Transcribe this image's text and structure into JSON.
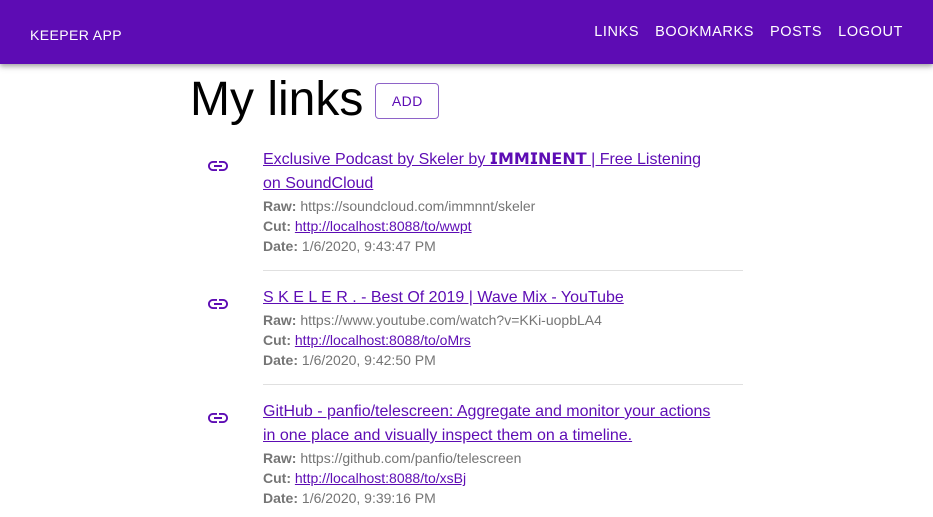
{
  "appbar": {
    "brand": "KEEPER APP",
    "nav": [
      "LINKS",
      "BOOKMARKS",
      "POSTS",
      "LOGOUT"
    ],
    "color": "#5d0cb4"
  },
  "page": {
    "title": "My links",
    "add_label": "ADD"
  },
  "labels": {
    "raw": "Raw:",
    "cut": "Cut:",
    "date": "Date:"
  },
  "links": [
    {
      "title": "Exclusive Podcast by Skeler by 𝗜𝗠𝗠𝗜𝗡𝗘𝗡𝗧 | Free Listening on SoundCloud",
      "raw": "https://soundcloud.com/immnnt/skeler",
      "cut": "http://localhost:8088/to/wwpt",
      "date": "1/6/2020, 9:43:47 PM",
      "icon": "link-icon"
    },
    {
      "title": " S K E L E R . - Best Of 2019 | Wave Mix - YouTube",
      "raw": "https://www.youtube.com/watch?v=KKi-uopbLA4",
      "cut": "http://localhost:8088/to/oMrs",
      "date": "1/6/2020, 9:42:50 PM",
      "icon": "link-icon"
    },
    {
      "title": "GitHub - panfio/telescreen: Aggregate and monitor your actions in one place and visually inspect them on a timeline.",
      "raw": "https://github.com/panfio/telescreen",
      "cut": "http://localhost:8088/to/xsBj",
      "date": "1/6/2020, 9:39:16 PM",
      "icon": "link-icon"
    }
  ]
}
